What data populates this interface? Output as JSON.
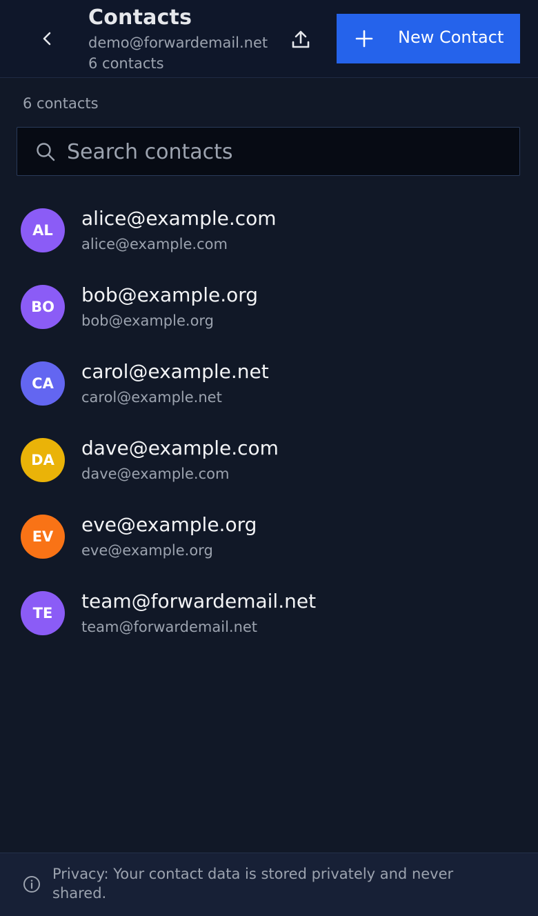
{
  "header": {
    "title": "Contacts",
    "account": "demo@forwardemail.net",
    "count_label": "6 contacts",
    "new_button_label": "New Contact"
  },
  "content": {
    "count_label": "6 contacts",
    "search": {
      "placeholder": "Search contacts",
      "value": ""
    }
  },
  "contacts": [
    {
      "initials": "AL",
      "name": "alice@example.com",
      "email": "alice@example.com",
      "color": "#8b5cf6"
    },
    {
      "initials": "BO",
      "name": "bob@example.org",
      "email": "bob@example.org",
      "color": "#8b5cf6"
    },
    {
      "initials": "CA",
      "name": "carol@example.net",
      "email": "carol@example.net",
      "color": "#6366f1"
    },
    {
      "initials": "DA",
      "name": "dave@example.com",
      "email": "dave@example.com",
      "color": "#eab308"
    },
    {
      "initials": "EV",
      "name": "eve@example.org",
      "email": "eve@example.org",
      "color": "#f97316"
    },
    {
      "initials": "TE",
      "name": "team@forwardemail.net",
      "email": "team@forwardemail.net",
      "color": "#8b5cf6"
    }
  ],
  "footer": {
    "privacy_text": "Privacy: Your contact data is stored privately and never shared."
  },
  "icons": {
    "back": "chevron-left-icon",
    "export": "upload-icon",
    "add": "plus-icon",
    "search": "search-icon",
    "info": "info-icon"
  },
  "colors": {
    "accent": "#2563eb",
    "background": "#111827",
    "header_bg": "#0f172a"
  }
}
